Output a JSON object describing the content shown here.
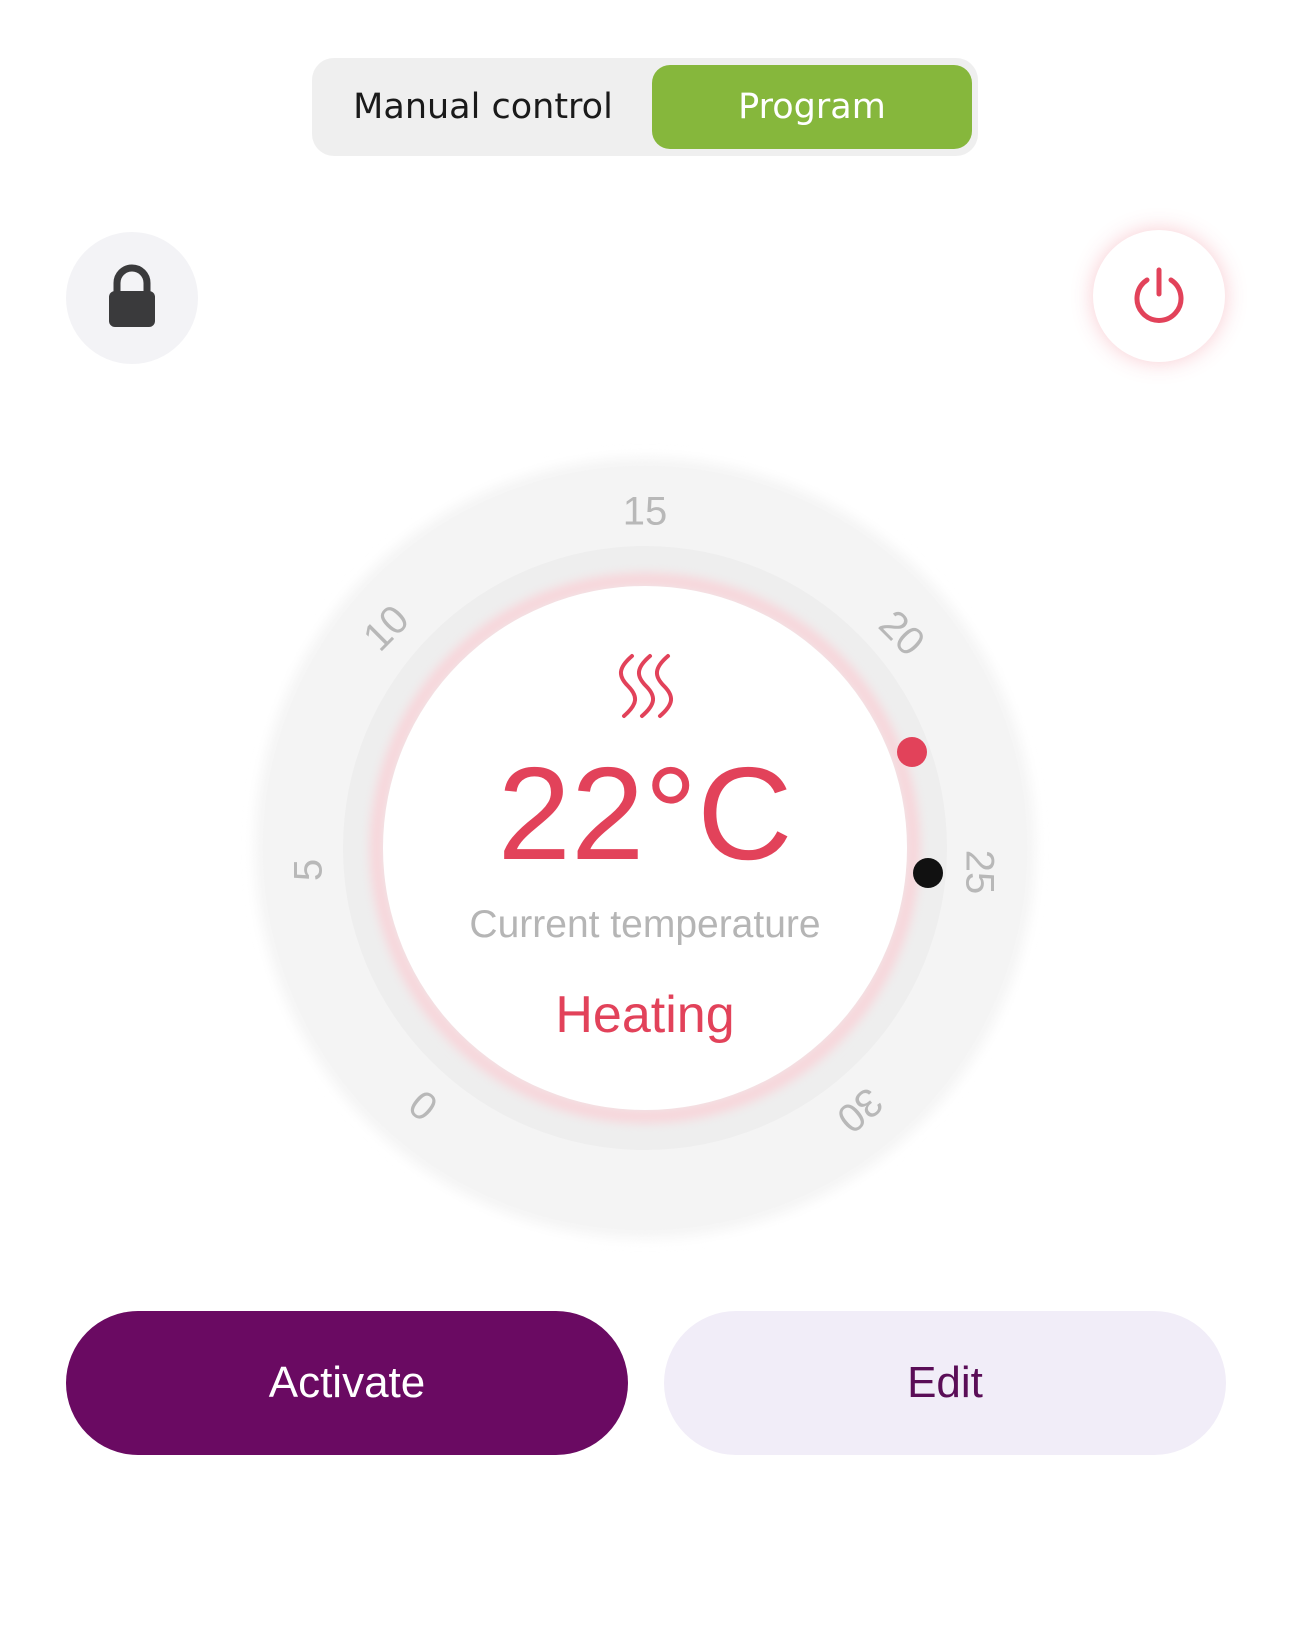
{
  "mode_switch": {
    "manual_label": "Manual control",
    "program_label": "Program",
    "selected": "Program"
  },
  "lock_button": {
    "icon": "lock-icon"
  },
  "power_button": {
    "icon": "power-icon"
  },
  "dial": {
    "ticks": [
      "0",
      "5",
      "10",
      "15",
      "20",
      "25",
      "30"
    ],
    "heat_icon": "heat-waves-icon",
    "temperature": "22°C",
    "temperature_label": "Current temperature",
    "status": "Heating"
  },
  "actions": {
    "activate_label": "Activate",
    "edit_label": "Edit"
  },
  "colors": {
    "accent_red": "#e2425a",
    "program_green": "#86b73c",
    "activate_purple": "#6a0a62",
    "edit_bg": "#f1edf8"
  }
}
